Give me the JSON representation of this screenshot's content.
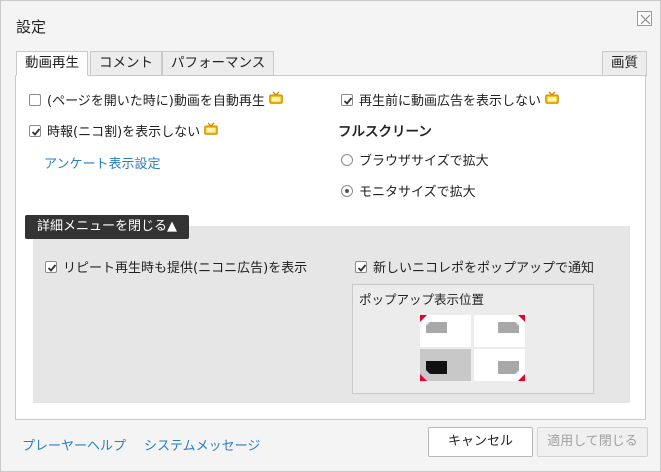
{
  "dialog": {
    "title": "設定"
  },
  "tabs": [
    {
      "label": "動画再生",
      "active": true
    },
    {
      "label": "コメント",
      "active": false
    },
    {
      "label": "パフォーマンス",
      "active": false
    },
    {
      "label": "画質",
      "active": false
    }
  ],
  "playback": {
    "autoplay": {
      "label": "(ページを開いた時に)動画を自動再生",
      "checked": false
    },
    "jiho": {
      "label": "時報(ニコ割)を表示しない",
      "checked": true
    },
    "survey_link": "アンケート表示設定",
    "no_preroll_ad": {
      "label": "再生前に動画広告を表示しない",
      "checked": true
    },
    "fullscreen": {
      "title": "フルスクリーン",
      "options": [
        {
          "label": "ブラウザサイズで拡大",
          "selected": false
        },
        {
          "label": "モニタサイズで拡大",
          "selected": true
        }
      ]
    }
  },
  "advanced": {
    "toggle_label": "詳細メニューを閉じる▲",
    "repeat_ads": {
      "label": "リピート再生時も提供(ニコニ広告)を表示",
      "checked": true
    },
    "nicorepo_popup": {
      "label": "新しいニコレポをポップアップで通知",
      "checked": true
    },
    "popup_position": {
      "label": "ポップアップ表示位置",
      "selected": "bottom-left"
    }
  },
  "footer": {
    "help_link": "プレーヤーヘルプ",
    "system_msg_link": "システムメッセージ",
    "cancel_label": "キャンセル",
    "apply_label": "適用して閉じる"
  },
  "colors": {
    "accent": "#e4002b",
    "link": "#2a7ec5",
    "premium": "#e8a400"
  }
}
